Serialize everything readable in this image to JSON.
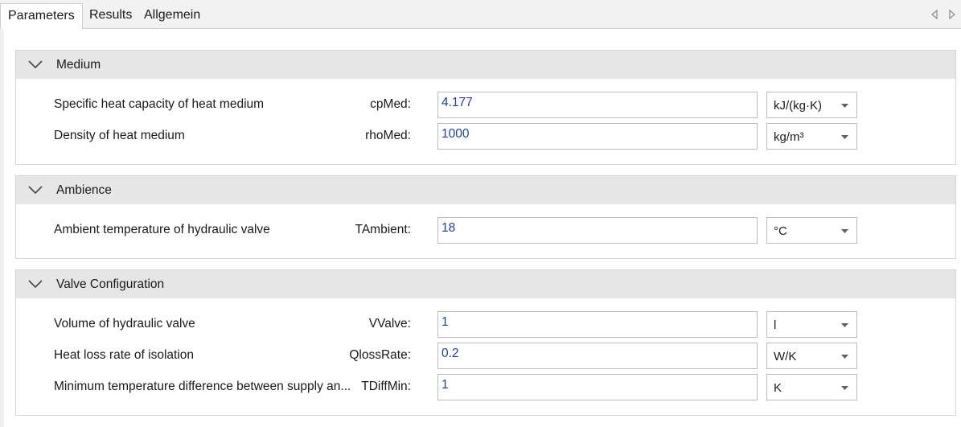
{
  "tabs": [
    {
      "label": "Parameters",
      "active": true
    },
    {
      "label": "Results",
      "active": false
    },
    {
      "label": "Allgemein",
      "active": false
    }
  ],
  "colors": {
    "value_text": "#1f3fa8",
    "header_bg": "#e6e6e6",
    "border": "#d6d6d6"
  },
  "sections": [
    {
      "title": "Medium",
      "rows": [
        {
          "label": "Specific heat capacity of heat medium",
          "var": "cpMed:",
          "value": "4.177",
          "unit": "kJ/(kg·K)"
        },
        {
          "label": "Density of heat medium",
          "var": "rhoMed:",
          "value": "1000",
          "unit": "kg/m³"
        }
      ]
    },
    {
      "title": "Ambience",
      "rows": [
        {
          "label": "Ambient temperature of hydraulic valve",
          "var": "TAmbient:",
          "value": "18",
          "unit": "°C"
        }
      ]
    },
    {
      "title": "Valve Configuration",
      "rows": [
        {
          "label": "Volume of hydraulic valve",
          "var": "VValve:",
          "value": "1",
          "unit": "l"
        },
        {
          "label": "Heat loss rate of isolation",
          "var": "QlossRate:",
          "value": "0.2",
          "unit": "W/K"
        },
        {
          "label": "Minimum temperature difference between supply an...",
          "var": "TDiffMin:",
          "value": "1",
          "unit": "K"
        }
      ]
    }
  ]
}
